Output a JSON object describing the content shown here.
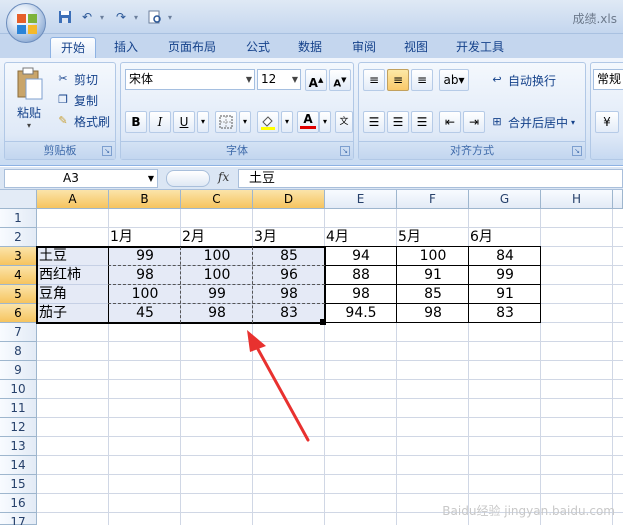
{
  "window": {
    "title": "成绩.xls"
  },
  "tabs": [
    "开始",
    "插入",
    "页面布局",
    "公式",
    "数据",
    "审阅",
    "视图",
    "开发工具"
  ],
  "clipboard": {
    "paste": "粘贴",
    "cut": "剪切",
    "copy": "复制",
    "format_painter": "格式刷",
    "label": "剪贴板"
  },
  "font": {
    "name": "宋体",
    "size": "12",
    "bold": "B",
    "italic": "I",
    "underline": "U",
    "grow": "A",
    "shrink": "A",
    "label": "字体"
  },
  "alignment": {
    "wrap": "自动换行",
    "merge": "合并后居中",
    "label": "对齐方式"
  },
  "number": {
    "format": "常规"
  },
  "formula_bar": {
    "cell_ref": "A3",
    "fx": "fx",
    "content": "土豆"
  },
  "columns": [
    "A",
    "B",
    "C",
    "D",
    "E",
    "F",
    "G",
    "H"
  ],
  "rows": [
    "1",
    "2",
    "3",
    "4",
    "5",
    "6",
    "7",
    "8",
    "9",
    "10",
    "11",
    "12",
    "13",
    "14",
    "15",
    "16",
    "17"
  ],
  "sheet": {
    "month_headers": [
      "1月",
      "2月",
      "3月",
      "4月",
      "5月",
      "6月"
    ],
    "data": [
      {
        "name": "土豆",
        "values": [
          "99",
          "100",
          "85",
          "94",
          "100",
          "84"
        ]
      },
      {
        "name": "西红柿",
        "values": [
          "98",
          "100",
          "96",
          "88",
          "91",
          "99"
        ]
      },
      {
        "name": "豆角",
        "values": [
          "100",
          "99",
          "98",
          "98",
          "85",
          "91"
        ]
      },
      {
        "name": "茄子",
        "values": [
          "45",
          "98",
          "83",
          "94.5",
          "98",
          "83"
        ]
      }
    ]
  },
  "watermark": "Baidu经验 jingyan.baidu.com"
}
